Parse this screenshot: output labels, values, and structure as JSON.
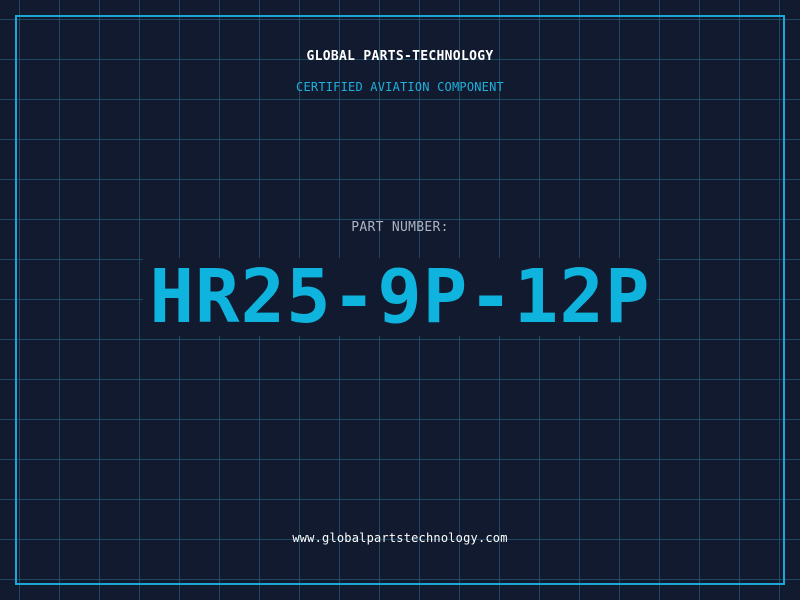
{
  "header": {
    "company": "GLOBAL PARTS-TECHNOLOGY",
    "subtitle": "CERTIFIED AVIATION COMPONENT"
  },
  "part": {
    "label": "PART NUMBER:",
    "number": "HR25-9P-12P"
  },
  "footer": {
    "website": "www.globalpartstechnology.com"
  },
  "colors": {
    "background": "#121a2f",
    "grid": "#286e8c",
    "accent": "#0fb4de",
    "text": "#ffffff",
    "muted": "#aab4c4"
  }
}
